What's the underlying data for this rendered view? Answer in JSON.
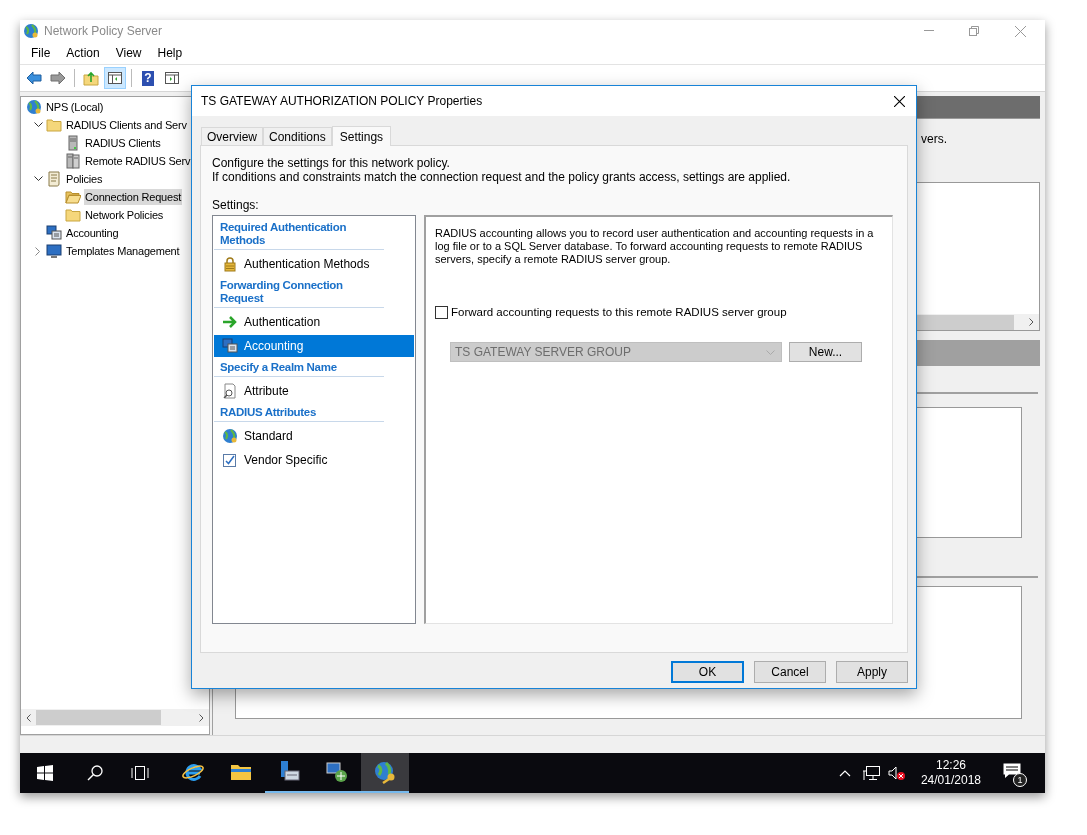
{
  "window": {
    "title": "Network Policy Server"
  },
  "menu": [
    "File",
    "Action",
    "View",
    "Help"
  ],
  "toolbar": [
    {
      "kind": "back",
      "pressed": false
    },
    {
      "kind": "forward",
      "pressed": false
    },
    {
      "kind": "up",
      "pressed": false
    },
    {
      "kind": "tree",
      "pressed": true
    },
    {
      "kind": "help",
      "pressed": false,
      "label": "?"
    },
    {
      "kind": "pane",
      "pressed": false
    }
  ],
  "tree": [
    {
      "label": "NPS (Local)",
      "kind": "globe",
      "selected": false,
      "children": [
        {
          "label": "RADIUS Clients and Serv",
          "kind": "folder",
          "selected": false,
          "expanded": true,
          "children": [
            {
              "label": "RADIUS Clients",
              "kind": "server",
              "selected": false
            },
            {
              "label": "Remote RADIUS Serv",
              "kind": "servers",
              "selected": false
            }
          ]
        },
        {
          "label": "Policies",
          "kind": "scroll",
          "selected": false,
          "expanded": true,
          "children": [
            {
              "label": "Connection Request",
              "kind": "folder-open",
              "selected": true
            },
            {
              "label": "Network Policies",
              "kind": "folder",
              "selected": false
            }
          ]
        },
        {
          "label": "Accounting",
          "kind": "computer",
          "selected": false
        },
        {
          "label": "Templates Management",
          "kind": "monitor",
          "selected": false,
          "expanded": false
        }
      ]
    }
  ],
  "right_pane": {
    "text_fragment": "vers."
  },
  "dialog": {
    "title": "TS GATEWAY AUTHORIZATION POLICY Properties",
    "tabs": [
      {
        "label": "Overview",
        "selected": false
      },
      {
        "label": "Conditions",
        "selected": false
      },
      {
        "label": "Settings",
        "selected": true
      }
    ],
    "description": [
      "Configure the settings for this network policy.",
      "If conditions and constraints match the connection request and the policy grants access, settings are applied."
    ],
    "settings_label": "Settings:",
    "settings": [
      {
        "kind": "heading",
        "label": "Required Authentication Methods"
      },
      {
        "kind": "lock",
        "label": "Authentication Methods",
        "selected": false
      },
      {
        "kind": "heading",
        "label": "Forwarding Connection Request"
      },
      {
        "kind": "arrow",
        "label": "Authentication",
        "selected": false
      },
      {
        "kind": "computer",
        "label": "Accounting",
        "selected": true
      },
      {
        "kind": "heading",
        "label": "Specify a Realm Name"
      },
      {
        "kind": "magnifier",
        "label": "Attribute",
        "selected": false
      },
      {
        "kind": "heading",
        "label": "RADIUS Attributes"
      },
      {
        "kind": "globe",
        "label": "Standard",
        "selected": false
      },
      {
        "kind": "check",
        "label": "Vendor Specific",
        "selected": false
      }
    ],
    "detail": {
      "description": "RADIUS accounting allows you to record user authentication and accounting requests in a log file or to a SQL Server database. To forward accounting requests to remote RADIUS servers, specify a remote RADIUS server group.",
      "checkbox": {
        "label": "Forward accounting requests to this remote RADIUS server group",
        "checked": false
      },
      "dropdown": {
        "value": "TS GATEWAY SERVER GROUP",
        "disabled": true
      },
      "new_button": "New..."
    },
    "buttons": [
      {
        "label": "OK",
        "default": true
      },
      {
        "label": "Cancel",
        "default": false
      },
      {
        "label": "Apply",
        "default": false
      }
    ]
  },
  "taskbar": {
    "apps": [
      {
        "kind": "ie",
        "running": false,
        "active": false
      },
      {
        "kind": "explorer",
        "running": false,
        "active": false
      },
      {
        "kind": "server-manager",
        "running": true,
        "active": false
      },
      {
        "kind": "network",
        "running": true,
        "active": false
      },
      {
        "kind": "nps",
        "running": true,
        "active": true
      }
    ],
    "time": "12:26",
    "date": "24/01/2018",
    "notifications": "1"
  }
}
